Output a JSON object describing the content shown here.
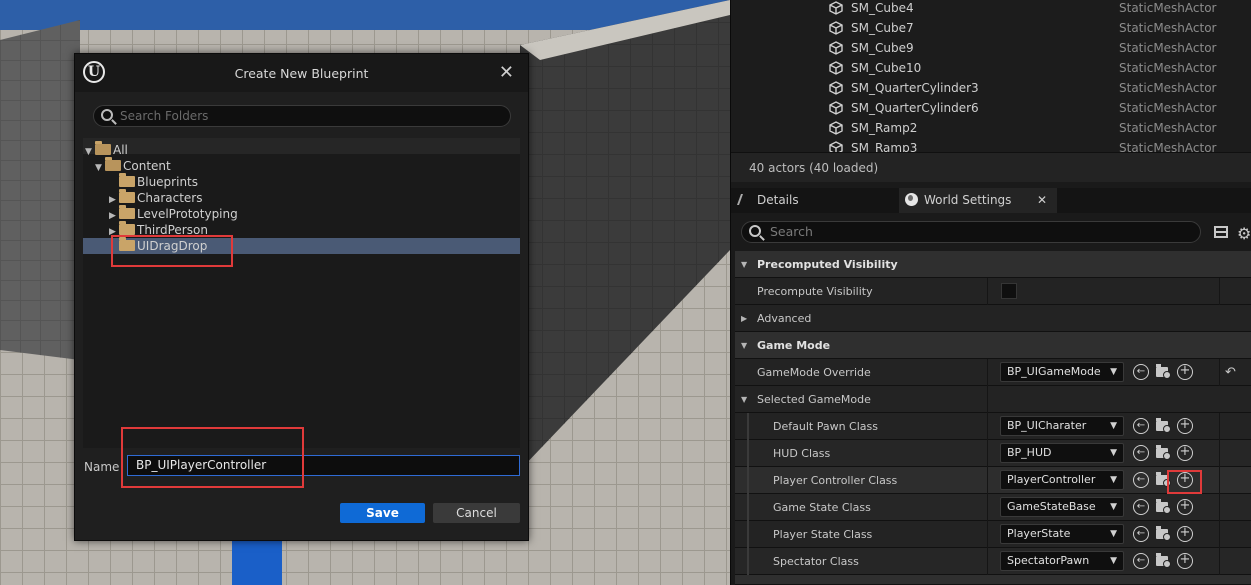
{
  "dialog": {
    "title": "Create New Blueprint",
    "search_placeholder": "Search Folders",
    "tree": {
      "all": "All",
      "content": "Content",
      "folders": [
        "Blueprints",
        "Characters",
        "LevelPrototyping",
        "ThirdPerson",
        "UIDragDrop"
      ],
      "selected": "UIDragDrop"
    },
    "name_label": "Name",
    "name_value": "BP_UIPlayerController",
    "save_label": "Save",
    "cancel_label": "Cancel"
  },
  "outliner": {
    "rows": [
      {
        "name": "SM_Cube4",
        "type": "StaticMeshActor"
      },
      {
        "name": "SM_Cube7",
        "type": "StaticMeshActor"
      },
      {
        "name": "SM_Cube9",
        "type": "StaticMeshActor"
      },
      {
        "name": "SM_Cube10",
        "type": "StaticMeshActor"
      },
      {
        "name": "SM_QuarterCylinder3",
        "type": "StaticMeshActor"
      },
      {
        "name": "SM_QuarterCylinder6",
        "type": "StaticMeshActor"
      },
      {
        "name": "SM_Ramp2",
        "type": "StaticMeshActor"
      },
      {
        "name": "SM_Ramp3",
        "type": "StaticMeshActor"
      }
    ],
    "status": "40 actors (40 loaded)"
  },
  "tabs": {
    "details": "Details",
    "world_settings": "World Settings"
  },
  "details": {
    "search_placeholder": "Search",
    "precomputed_visibility": "Precomputed Visibility",
    "precompute_visibility": "Precompute Visibility",
    "advanced": "Advanced",
    "game_mode": "Game Mode",
    "gamemode_override": {
      "label": "GameMode Override",
      "value": "BP_UIGameMode"
    },
    "selected_gamemode": "Selected GameMode",
    "classes": [
      {
        "label": "Default Pawn Class",
        "value": "BP_UICharater"
      },
      {
        "label": "HUD Class",
        "value": "BP_HUD"
      },
      {
        "label": "Player Controller Class",
        "value": "PlayerController"
      },
      {
        "label": "Game State Class",
        "value": "GameStateBase"
      },
      {
        "label": "Player State Class",
        "value": "PlayerState"
      },
      {
        "label": "Spectator Class",
        "value": "SpectatorPawn"
      }
    ]
  }
}
